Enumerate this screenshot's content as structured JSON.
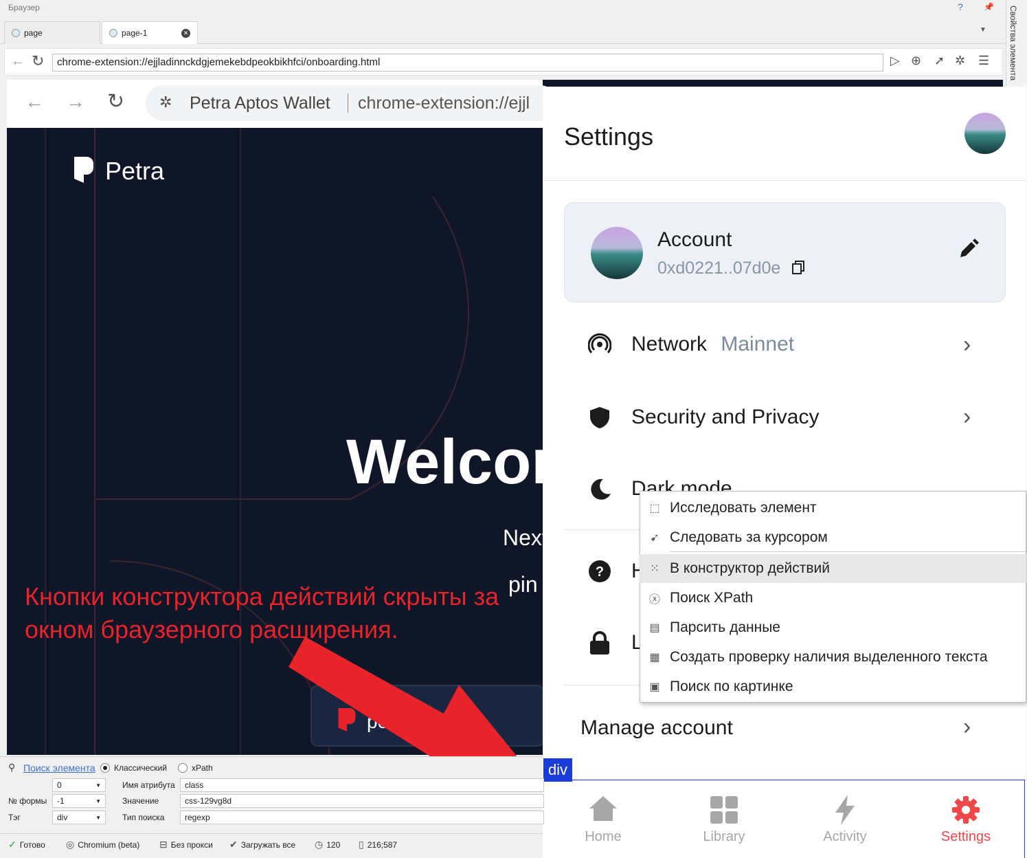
{
  "host": {
    "title": "Браузер",
    "right_panel_label": "Свойства элемента",
    "tabs": [
      {
        "label": "page"
      },
      {
        "label": "page-1"
      }
    ],
    "url": "chrome-extension://ejjladinnckdgjemekebdpeokbikhfci/onboarding.html"
  },
  "browser": {
    "tab_title": "Petra Aptos Wallet",
    "url_fragment": "chrome-extension://ejjl",
    "brand": "Petra",
    "welcome_text": "Welcor",
    "next_text": "Next",
    "pin_text": "pin",
    "card_text": "pe"
  },
  "annotation": "Кнопки конструктора действий скрыты за окном браузерного расширения.",
  "settings": {
    "title": "Settings",
    "account": {
      "name": "Account",
      "address": "0xd0221..07d0e"
    },
    "rows": {
      "network_label": "Network",
      "network_value": "Mainnet",
      "security_label": "Security and Privacy",
      "dark_label": "Dark mode",
      "help_label": "H",
      "lock_label": "L",
      "manage_label": "Manage account"
    },
    "nav": {
      "home": "Home",
      "library": "Library",
      "activity": "Activity",
      "settings": "Settings"
    }
  },
  "context_menu": {
    "items": [
      {
        "label": "Исследовать элемент",
        "icon": "inspect-cursor-icon"
      },
      {
        "label": "Следовать за курсором",
        "icon": "follow-cursor-icon"
      },
      {
        "label": "В конструктор действий",
        "icon": "grid-dots-icon"
      },
      {
        "label": "Поиск XPath",
        "icon": "xpath-circle-icon"
      },
      {
        "label": "Парсить данные",
        "icon": "parse-doc-icon"
      },
      {
        "label": "Создать проверку наличия выделенного текста",
        "icon": "text-doc-icon"
      },
      {
        "label": "Поиск по картинке",
        "icon": "image-icon"
      }
    ]
  },
  "highlight_tag": "div",
  "inspector": {
    "find_link": "Поиск элемента",
    "mode_classic": "Классический",
    "mode_xpath": "xPath",
    "form_label": "№ формы",
    "tag_label": "Тэг",
    "combo_index": "0",
    "combo_form": "-1",
    "combo_tag": "div",
    "attr_name_label": "Имя атрибута",
    "value_label": "Значение",
    "search_type_label": "Тип поиска",
    "attr_name": "class",
    "value": "css-129vg8d",
    "search_type": "regexp"
  },
  "status": {
    "ready": "Готово",
    "engine": "Chromium (beta)",
    "proxy": "Без прокси",
    "load": "Загружать все",
    "timeout": "120",
    "coords": "216;587"
  },
  "colors": {
    "accent_red": "#e8242a",
    "settings_active": "#f0474b",
    "highlight_blue": "#1a3dd8",
    "dark_bg": "#0e1628"
  }
}
